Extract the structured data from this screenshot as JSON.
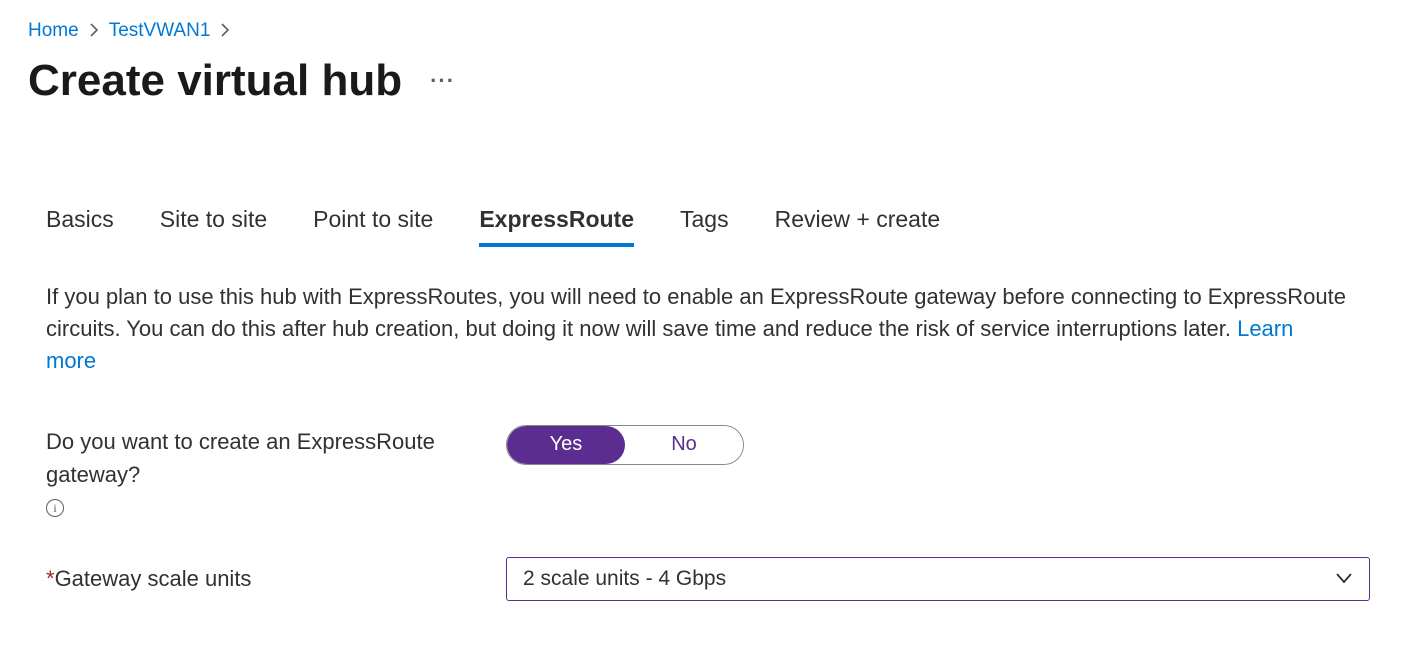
{
  "breadcrumb": {
    "home": "Home",
    "vwan": "TestVWAN1"
  },
  "page": {
    "title": "Create virtual hub"
  },
  "tabs": {
    "basics": "Basics",
    "s2s": "Site to site",
    "p2s": "Point to site",
    "er": "ExpressRoute",
    "tags": "Tags",
    "review": "Review + create"
  },
  "description": {
    "text": "If you plan to use this hub with ExpressRoutes, you will need to enable an ExpressRoute gateway before connecting to ExpressRoute circuits. You can do this after hub creation, but doing it now will save time and reduce the risk of service interruptions later.  ",
    "learn_more": "Learn more"
  },
  "form": {
    "create_gateway_label": "Do you want to create an ExpressRoute gateway?",
    "toggle_yes": "Yes",
    "toggle_no": "No",
    "scale_units_label": "Gateway scale units",
    "scale_units_value": "2 scale units - 4 Gbps"
  }
}
